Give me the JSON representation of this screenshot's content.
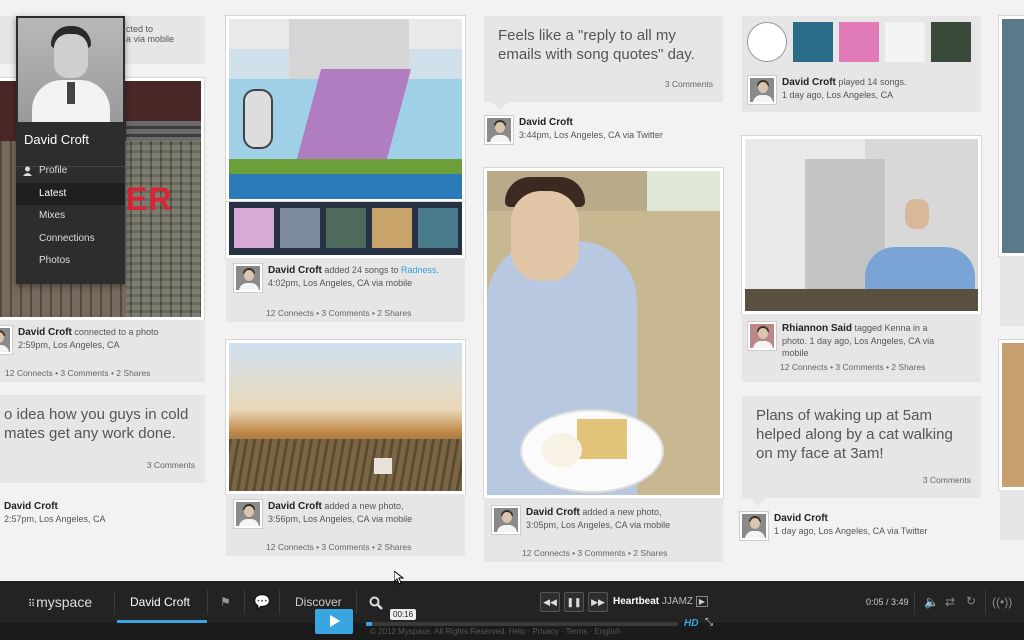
{
  "profile_menu": {
    "name": "David Croft",
    "items": [
      "Profile",
      "Latest",
      "Mixes",
      "Connections",
      "Photos"
    ],
    "active": "Latest"
  },
  "col1": {
    "top_meta": "cted to\na via mobile",
    "photo_sign": "ER",
    "connect": {
      "name": "David Croft",
      "action": " connected to a photo",
      "sub": "2:59pm, Los Angeles, CA"
    },
    "connect_stats": "12 Connects  •  3 Comments  •  2 Shares",
    "quote": "o idea how you guys in cold mates get any work done.",
    "quote_count": "3 Comments",
    "author": {
      "name": "David Croft",
      "sub": "2:57pm, Los Angeles, CA"
    }
  },
  "col2": {
    "mix": {
      "name": "David Croft",
      "action": " added 24 songs to ",
      "link": "Radness",
      "end": ".",
      "sub": "4:02pm, Los Angeles, CA via mobile"
    },
    "mix_stats": "12 Connects  •  3 Comments  •  2 Shares",
    "photo": {
      "name": "David Croft",
      "action": " added a new photo,",
      "sub": "3:56pm, Los Angeles, CA via mobile"
    },
    "photo_stats": "12 Connects  •  3 Comments  •  2 Shares"
  },
  "col3": {
    "quote": "Feels like a \"reply to all my emails with song quotes\" day.",
    "quote_count": "3 Comments",
    "author": {
      "name": "David Croft",
      "sub": "3:44pm, Los Angeles, CA via Twitter"
    },
    "photo": {
      "name": "David Croft",
      "action": " added a new photo,",
      "sub": "3:05pm, Los Angeles, CA via mobile"
    },
    "photo_stats": "12 Connects  •  3 Comments  •  2 Shares"
  },
  "col4": {
    "played": {
      "name": "David Croft",
      "action": " played 14 songs.",
      "sub": "1 day ago, Los Angeles, CA"
    },
    "tag": {
      "name": "Rhiannon Said",
      "action": " tagged Kenna in a photo.",
      "sub": "1 day ago, Los Angeles, CA via mobile"
    },
    "tag_stats": "12 Connects  •  3 Comments  •  2 Shares",
    "quote": "Plans of waking up at 5am helped along by a cat walking on my face at 3am!",
    "quote_count": "3 Comments",
    "author": {
      "name": "David Croft",
      "sub": "1 day ago, Los Angeles, CA via Twitter"
    }
  },
  "player": {
    "logo": "myspace",
    "user": "David Croft",
    "discover": "Discover",
    "track": "Heartbeat",
    "artist": "JJAMZ",
    "time": "0:05 / 3:49",
    "tooltip": "00:16",
    "hd": "HD",
    "progress": 0.02,
    "footer": "© 2012 Myspace. All Rights Reserved. Help · Privacy · Terms · English"
  },
  "colors": {
    "accent": "#39a4dd",
    "bar": "#232323"
  },
  "icons": [
    "user-icon",
    "flag-icon",
    "chat-icon",
    "search-icon",
    "rewind-icon",
    "pause-icon",
    "forward-icon",
    "volume-icon",
    "shuffle-icon",
    "repeat-icon",
    "radio-icon",
    "expand-icon",
    "play-icon"
  ]
}
